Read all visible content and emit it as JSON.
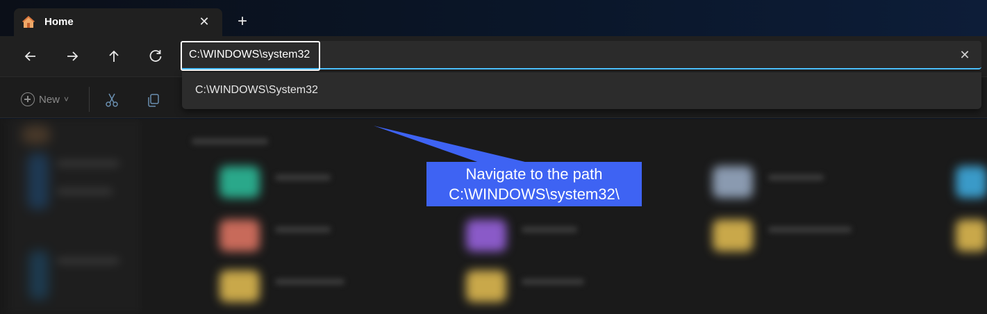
{
  "tab": {
    "title": "Home",
    "close_glyph": "✕",
    "new_tab_glyph": "+"
  },
  "nav": {
    "back_icon": "arrow-left-icon",
    "forward_icon": "arrow-right-icon",
    "up_icon": "arrow-up-icon",
    "refresh_icon": "refresh-icon"
  },
  "address": {
    "value": "C:\\WINDOWS\\system32",
    "clear_glyph": "✕"
  },
  "suggestions": [
    {
      "label": "C:\\WINDOWS\\System32"
    }
  ],
  "toolbar": {
    "new_label": "New",
    "new_chevron": "˅"
  },
  "callout": {
    "line1": "Navigate to the path",
    "line2": "C:\\WINDOWS\\system32\\"
  },
  "colors": {
    "accent": "#4cc2ff",
    "callout": "#3e63f3",
    "home_icon": "#f0a868"
  }
}
